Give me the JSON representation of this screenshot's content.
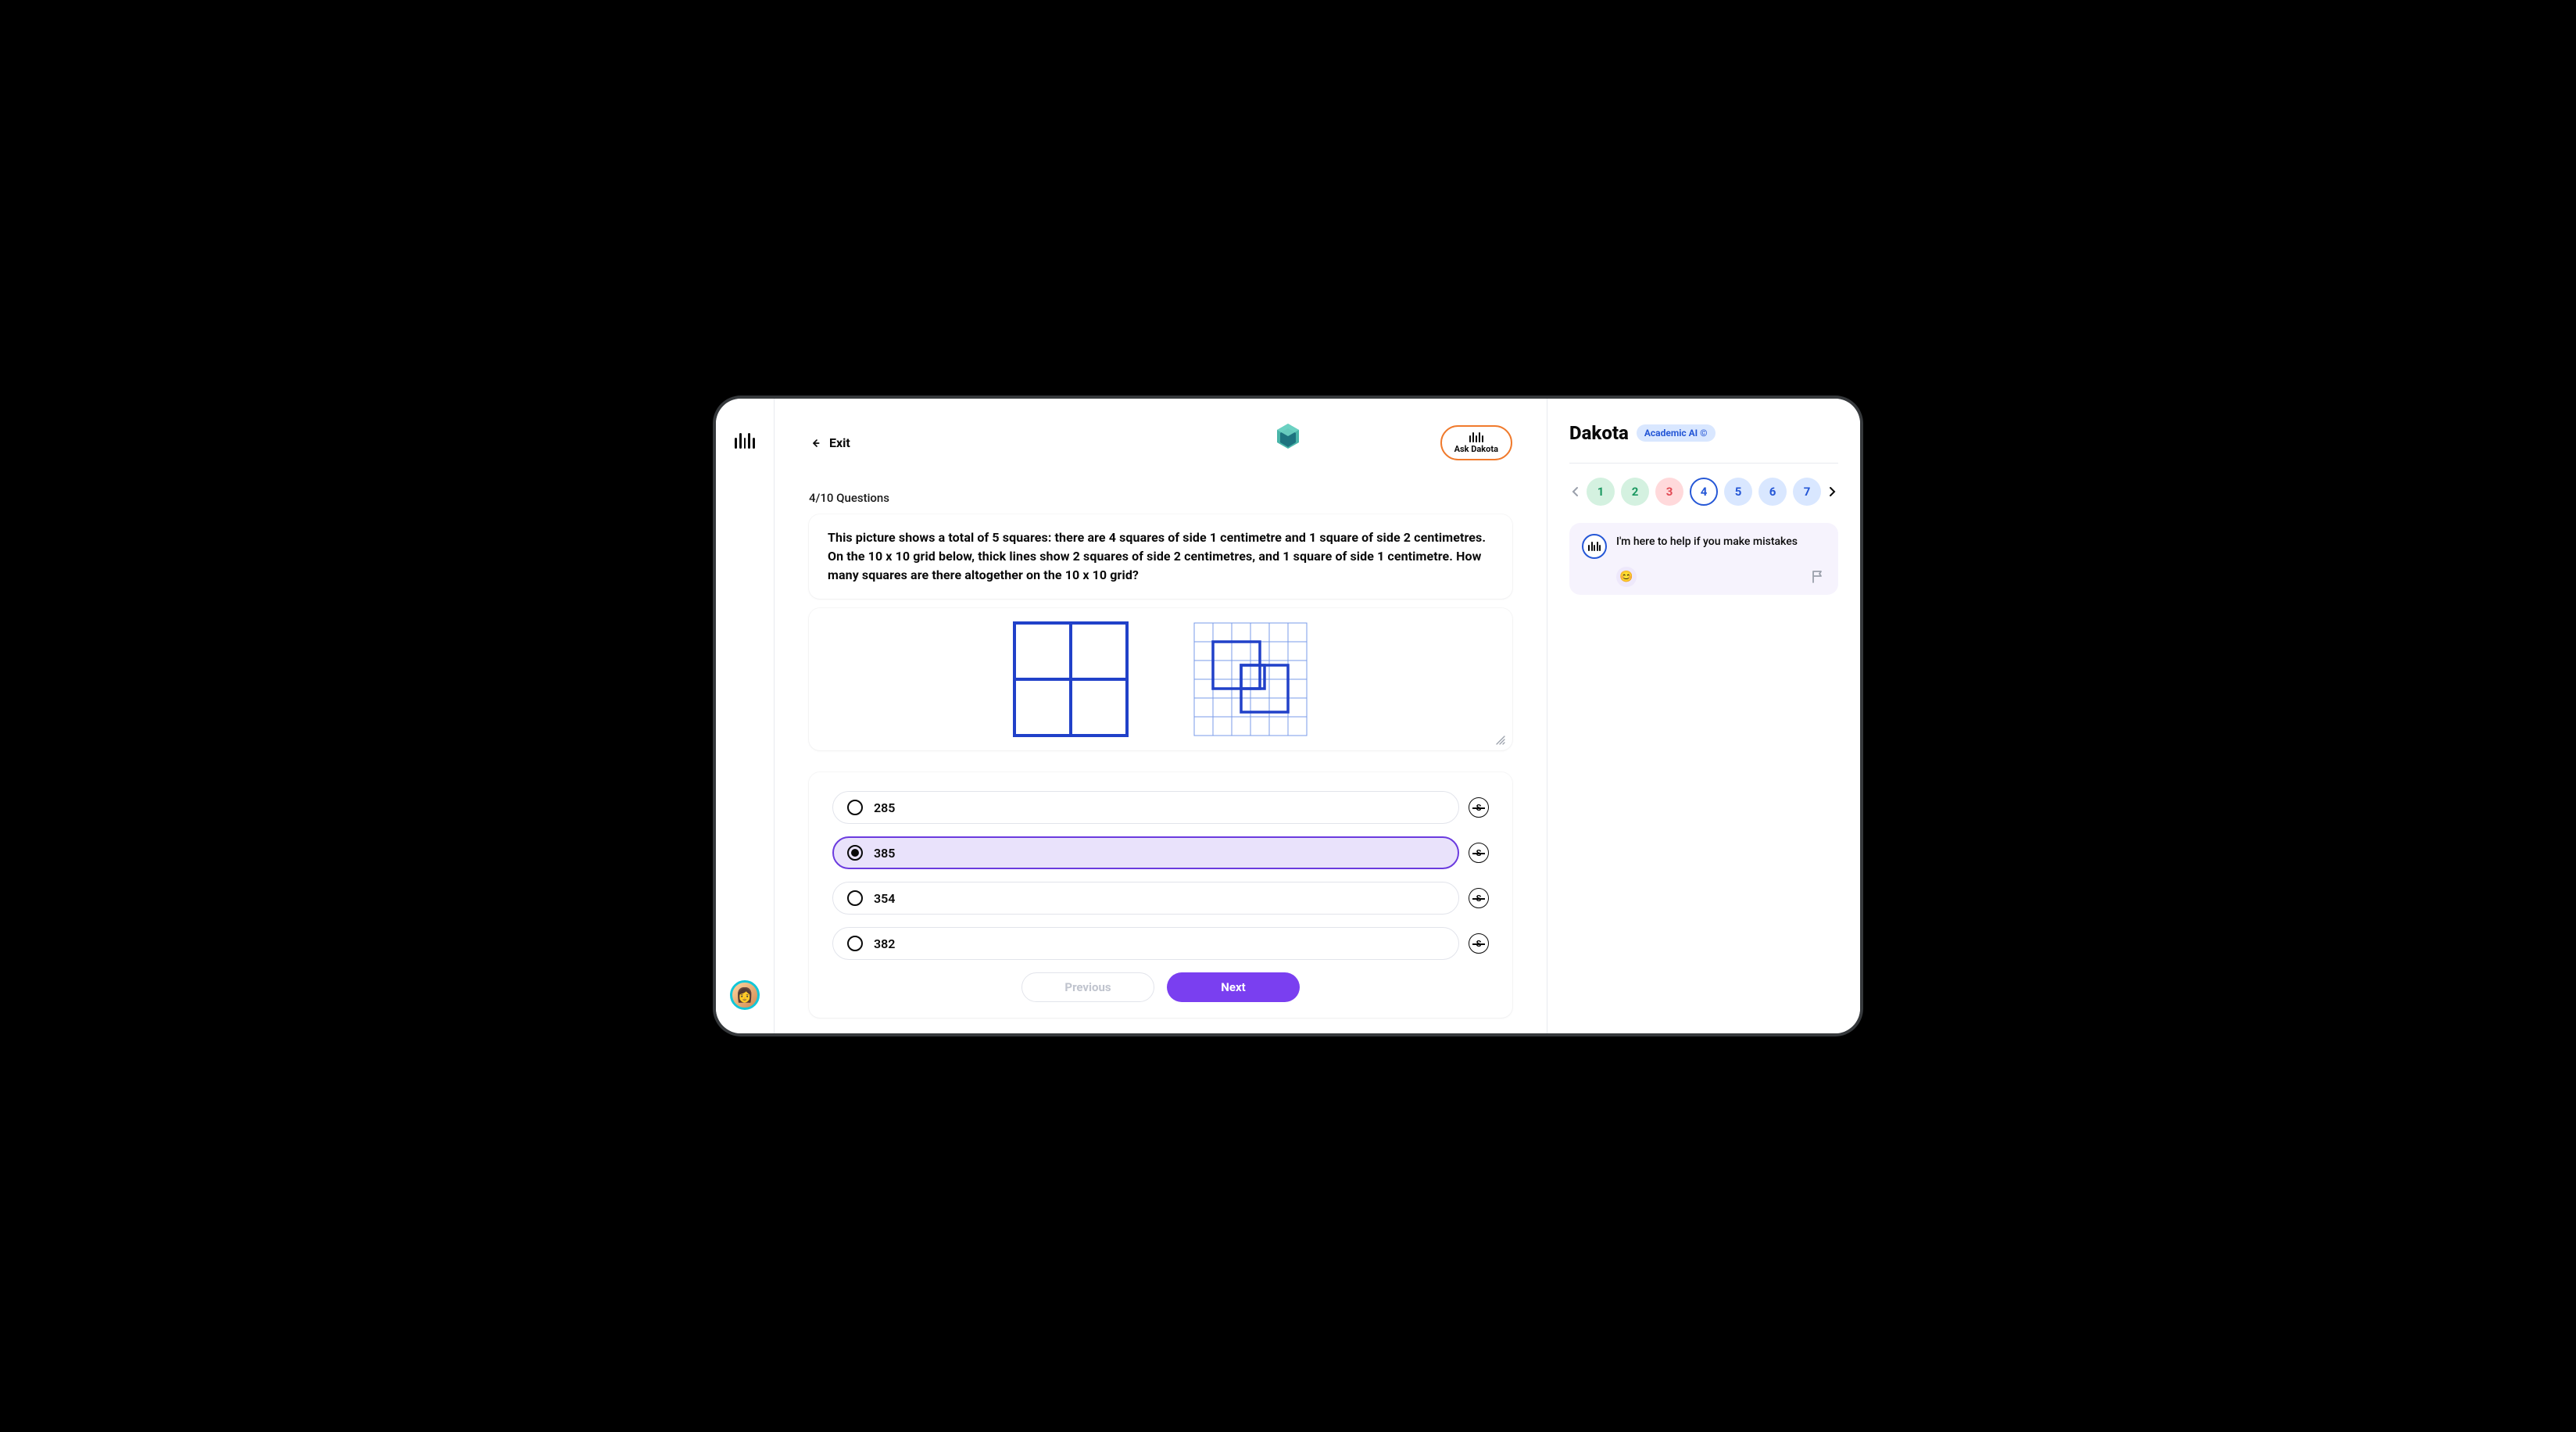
{
  "header": {
    "exit_label": "Exit",
    "ask_button": "Ask Dakota"
  },
  "question": {
    "progress": "4/10 Questions",
    "text": "This picture shows a total of 5 squares: there are 4 squares of side 1 centimetre and 1 square of side 2 centimetres. On the 10 x 10 grid below, thick lines show 2 squares of side 2 centimetres, and 1 square of side 1 centimetre. How many squares are there altogether on the 10 x 10 grid?"
  },
  "options": [
    {
      "label": "285",
      "selected": false
    },
    {
      "label": "385",
      "selected": true
    },
    {
      "label": "354",
      "selected": false
    },
    {
      "label": "382",
      "selected": false
    }
  ],
  "nav": {
    "previous": "Previous",
    "next": "Next"
  },
  "panel": {
    "title": "Dakota",
    "badge": "Academic AI ©",
    "message": "I'm here to help if you make mistakes",
    "questions": [
      {
        "num": "1",
        "state": "green"
      },
      {
        "num": "2",
        "state": "green"
      },
      {
        "num": "3",
        "state": "red"
      },
      {
        "num": "4",
        "state": "current"
      },
      {
        "num": "5",
        "state": "blue"
      },
      {
        "num": "6",
        "state": "blue"
      },
      {
        "num": "7",
        "state": "blue"
      }
    ]
  }
}
